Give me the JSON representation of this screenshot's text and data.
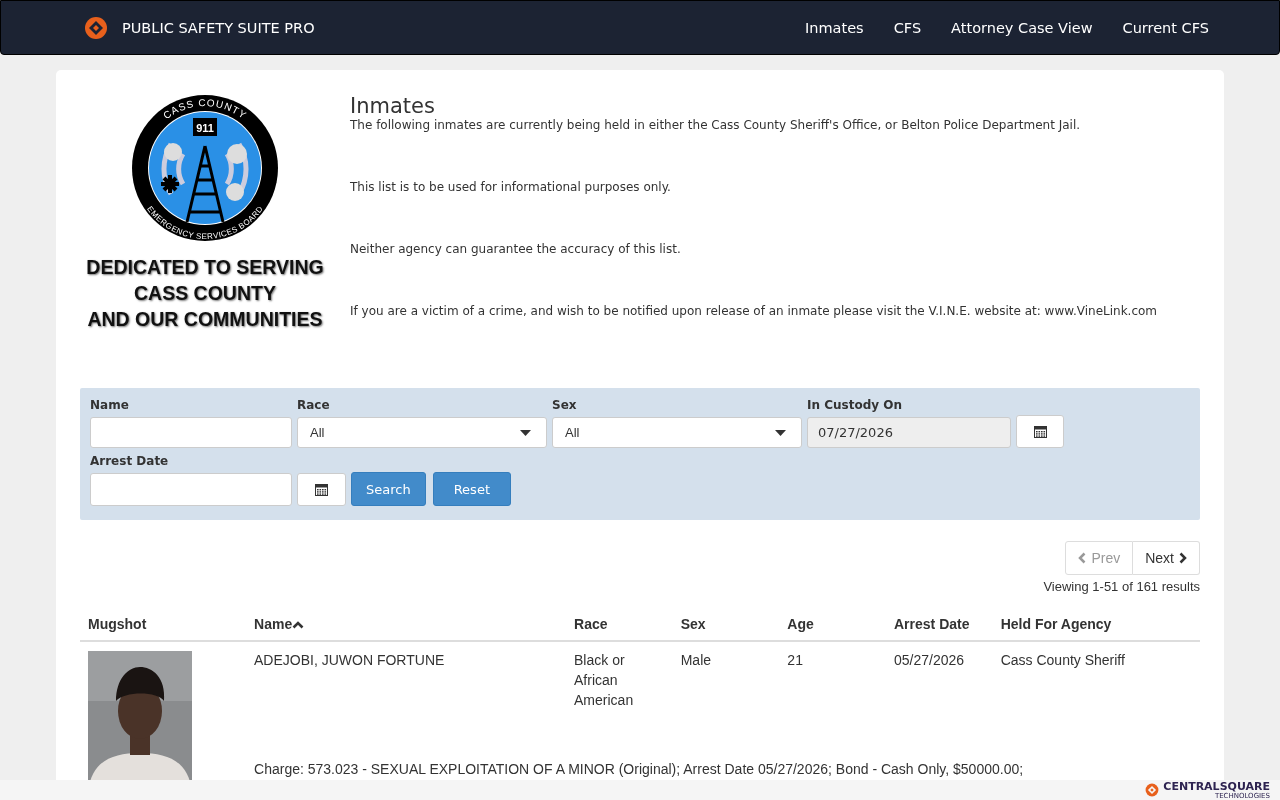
{
  "navbar": {
    "brand": "PUBLIC SAFETY SUITE PRO",
    "links": [
      {
        "label": "Inmates"
      },
      {
        "label": "CFS"
      },
      {
        "label": "Attorney Case View"
      },
      {
        "label": "Current CFS"
      }
    ]
  },
  "logo": {
    "seal_top": "CASS COUNTY",
    "seal_badge": "911",
    "seal_bottom": "EMERGENCY SERVICES BOARD",
    "tagline": [
      "DEDICATED TO SERVING",
      "CASS COUNTY",
      "AND OUR COMMUNITIES"
    ]
  },
  "intro": {
    "title": "Inmates",
    "paragraphs": [
      "The following inmates are currently being held in either the Cass County Sheriff's Office, or Belton Police Department Jail.",
      "This list is to be used for informational purposes only.",
      "Neither agency can guarantee the accuracy of this list.",
      "If you are a victim of a crime, and wish to be notified upon release of an inmate please visit the V.I.N.E. website at: www.VineLink.com"
    ]
  },
  "filters": {
    "name": {
      "label": "Name"
    },
    "race": {
      "label": "Race",
      "value": "All"
    },
    "sex": {
      "label": "Sex",
      "value": "All"
    },
    "in_custody_on": {
      "label": "In Custody On",
      "value": "07/27/2026",
      "disabled": true
    },
    "arrest_date": {
      "label": "Arrest Date"
    },
    "buttons": [
      "Search",
      "Reset"
    ]
  },
  "pager": {
    "prev": {
      "label": "Prev",
      "disabled": true
    },
    "next": {
      "label": "Next",
      "disabled": false
    },
    "summary": "Viewing 1-51 of 161 results"
  },
  "table": {
    "columns": [
      {
        "label": "Mugshot",
        "sorted": false
      },
      {
        "label": "Name",
        "sorted": true
      },
      {
        "label": "Race",
        "sorted": false
      },
      {
        "label": "Sex",
        "sorted": false
      },
      {
        "label": "Age",
        "sorted": false
      },
      {
        "label": "Arrest Date",
        "sorted": false
      },
      {
        "label": "Held For Agency",
        "sorted": false
      }
    ],
    "rows": [
      {
        "name": "ADEJOBI, JUWON FORTUNE",
        "race": "Black or African American",
        "sex": "Male",
        "age": "21",
        "arrest_date": "05/27/2026",
        "agency": "Cass County Sheriff",
        "charge": "Charge: 573.023 - SEXUAL EXPLOITATION OF A MINOR (Original); Arrest Date 05/27/2026; Bond - Cash Only, $50000.00;"
      }
    ]
  },
  "footer": {
    "brand": "CENTRALSQUARE",
    "sub": "TECHNOLOGIES"
  }
}
